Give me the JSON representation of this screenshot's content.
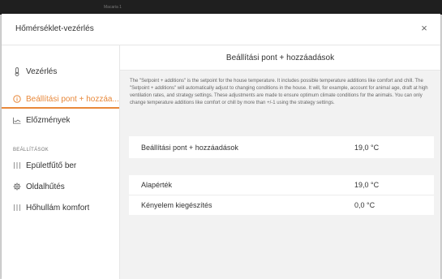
{
  "window": {
    "top_strip_text": "Macaria 1"
  },
  "dialog": {
    "title": "Hőmérséklet-vezérlés",
    "close_glyph": "×"
  },
  "sidebar": {
    "items": [
      {
        "label": "Vezérlés",
        "icon": "thermometer-icon"
      },
      {
        "label": "Beállítási pont + hozzáa...",
        "icon": "info-circle-icon",
        "active": true
      },
      {
        "label": "Előzmények",
        "icon": "chart-line-icon"
      }
    ],
    "section_label": "BEÁLLÍTÁSOK",
    "settings_items": [
      {
        "label": "Épületfűtő ber",
        "icon": "heater-icon"
      },
      {
        "label": "Oldalhűtés",
        "icon": "gear-icon"
      },
      {
        "label": "Hőhullám komfort",
        "icon": "heater-icon"
      }
    ]
  },
  "main": {
    "title": "Beállítási pont + hozzáadások",
    "description": "The \"Setpoint + additions\" is the setpoint for the house temperature. It includes possible temperature additions like comfort and chill. The \"Setpoint + additions\" will automatically adjust to changing conditions in the house. It will, for example, account for animal age, draft at high ventilation rates, and strategy settings. These adjustments are made to ensure optimum climate conditions for the animals. You can only change temperature additions like comfort or chill by more than +/-1 using the strategy settings.",
    "summary": {
      "label": "Beállítási pont + hozzáadások",
      "value": "19,0 °C"
    },
    "details": [
      {
        "label": "Alapérték",
        "value": "19,0 °C"
      },
      {
        "label": "Kényelem kiegészítés",
        "value": "0,0 °C"
      }
    ]
  },
  "colors": {
    "accent": "#e8883a",
    "panel_bg": "#f2f2f2",
    "topbar": "#1f1f1f"
  }
}
